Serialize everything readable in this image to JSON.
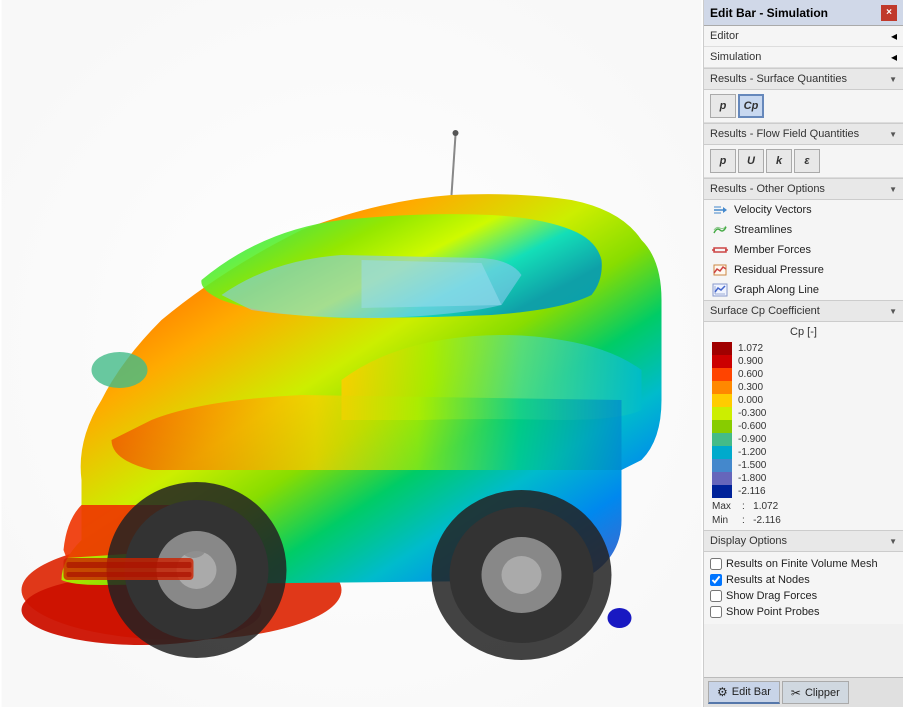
{
  "titleBar": {
    "title": "Edit Bar - Simulation",
    "closeLabel": "×"
  },
  "nav": {
    "editor": "Editor",
    "simulation": "Simulation"
  },
  "sections": {
    "surfaceQuantities": {
      "label": "Results - Surface Quantities",
      "buttons": [
        {
          "id": "p",
          "label": "p",
          "active": false,
          "italic": true
        },
        {
          "id": "cp",
          "label": "Cp",
          "active": true,
          "italic": false
        }
      ]
    },
    "flowFieldQuantities": {
      "label": "Results - Flow Field Quantities",
      "buttons": [
        {
          "id": "p2",
          "label": "p",
          "active": false,
          "italic": true
        },
        {
          "id": "u",
          "label": "U",
          "active": false,
          "italic": false
        },
        {
          "id": "k",
          "label": "k",
          "active": false,
          "italic": true
        },
        {
          "id": "eps",
          "label": "ε",
          "active": false,
          "italic": false
        }
      ]
    },
    "otherOptions": {
      "label": "Results - Other Options",
      "items": [
        {
          "id": "velocity",
          "label": "Velocity Vectors",
          "icon": "arrow"
        },
        {
          "id": "streamlines",
          "label": "Streamlines",
          "icon": "stream"
        },
        {
          "id": "memberForces",
          "label": "Member Forces",
          "icon": "force"
        },
        {
          "id": "residualPressure",
          "label": "Residual Pressure",
          "icon": "chart"
        },
        {
          "id": "graphAlongLine",
          "label": "Graph Along Line",
          "icon": "graph"
        }
      ]
    },
    "surfaceCp": {
      "label": "Surface Cp Coefficient",
      "legendTitle": "Cp [-]",
      "colorStops": [
        {
          "value": "1.072",
          "color": "#a00000"
        },
        {
          "value": "0.900",
          "color": "#cc0000"
        },
        {
          "value": "0.600",
          "color": "#ff4400"
        },
        {
          "value": "0.300",
          "color": "#ff8800"
        },
        {
          "value": "0.000",
          "color": "#ffcc00"
        },
        {
          "value": "-0.300",
          "color": "#ccee00"
        },
        {
          "value": "-0.600",
          "color": "#88cc00"
        },
        {
          "value": "-0.900",
          "color": "#44bb88"
        },
        {
          "value": "-1.200",
          "color": "#00aacc"
        },
        {
          "value": "-1.500",
          "color": "#4488cc"
        },
        {
          "value": "-1.800",
          "color": "#6666bb"
        },
        {
          "value": "-2.116",
          "color": "#002299"
        }
      ],
      "maxLabel": "Max",
      "minLabel": "Min",
      "maxValue": "1.072",
      "minValue": "-2.116",
      "separator": ":"
    },
    "displayOptions": {
      "label": "Display Options",
      "checkboxes": [
        {
          "id": "finiteMesh",
          "label": "Results on Finite Volume Mesh",
          "checked": false
        },
        {
          "id": "resultsAtNodes",
          "label": "Results at Nodes",
          "checked": true
        },
        {
          "id": "dragForces",
          "label": "Show Drag Forces",
          "checked": false
        },
        {
          "id": "pointProbes",
          "label": "Show Point Probes",
          "checked": false
        }
      ]
    }
  },
  "bottomTabs": [
    {
      "id": "editBar",
      "label": "Edit Bar",
      "icon": "⚙",
      "active": true
    },
    {
      "id": "clipper",
      "label": "Clipper",
      "icon": "✂",
      "active": false
    }
  ]
}
